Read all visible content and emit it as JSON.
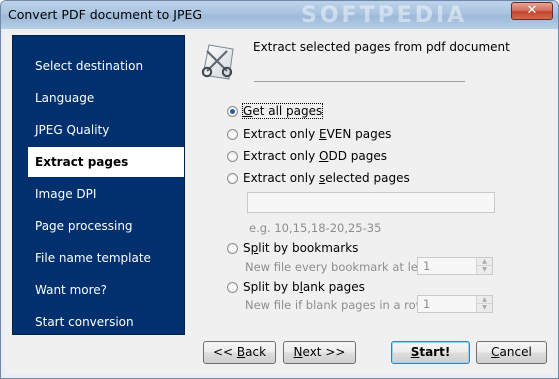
{
  "window": {
    "title": "Convert PDF document to JPEG",
    "watermark": "SOFTPEDIA",
    "close_glyph": "✕"
  },
  "sidebar": {
    "items": [
      {
        "label": "Select destination"
      },
      {
        "label": "Language"
      },
      {
        "label": "JPEG Quality"
      },
      {
        "label": "Extract pages",
        "active": true
      },
      {
        "label": "Image DPI"
      },
      {
        "label": "Page processing"
      },
      {
        "label": "File name template"
      },
      {
        "label": "Want more?"
      },
      {
        "label": "Start conversion"
      }
    ]
  },
  "header": {
    "icon": "scissors-icon",
    "text": "Extract selected pages from pdf document"
  },
  "options": {
    "all_pages": {
      "label_u": "G",
      "label_rest": "et all pages",
      "checked": true
    },
    "even": {
      "label_pre": "Extract only ",
      "label_u": "E",
      "label_rest": "VEN pages"
    },
    "odd": {
      "label_pre": "Extract only ",
      "label_u": "O",
      "label_rest": "DD pages"
    },
    "selected": {
      "label_pre": "Extract only ",
      "label_u": "s",
      "label_rest": "elected pages"
    },
    "pages_value": "",
    "example": "e.g. 10,15,18-20,25-35",
    "split_bookmarks": {
      "label_pre": "S",
      "label_u": "p",
      "label_rest": "lit by bookmarks"
    },
    "bookmark_level_label": "New file every bookmark at level:",
    "bookmark_level_value": "1",
    "split_blank": {
      "label_pre": "Split by b",
      "label_u": "l",
      "label_rest": "ank pages"
    },
    "blank_pages_label": "New file if blank pages in a row:",
    "blank_pages_value": "1"
  },
  "buttons": {
    "back": {
      "pre": "<< ",
      "u": "B",
      "rest": "ack"
    },
    "next": {
      "u": "N",
      "rest": "ext >>"
    },
    "start": {
      "u": "S",
      "rest": "tart!"
    },
    "cancel": {
      "u": "C",
      "rest": "ancel"
    }
  },
  "colors": {
    "sidebar_bg": "#00306e",
    "accent": "#1c5f9c"
  }
}
